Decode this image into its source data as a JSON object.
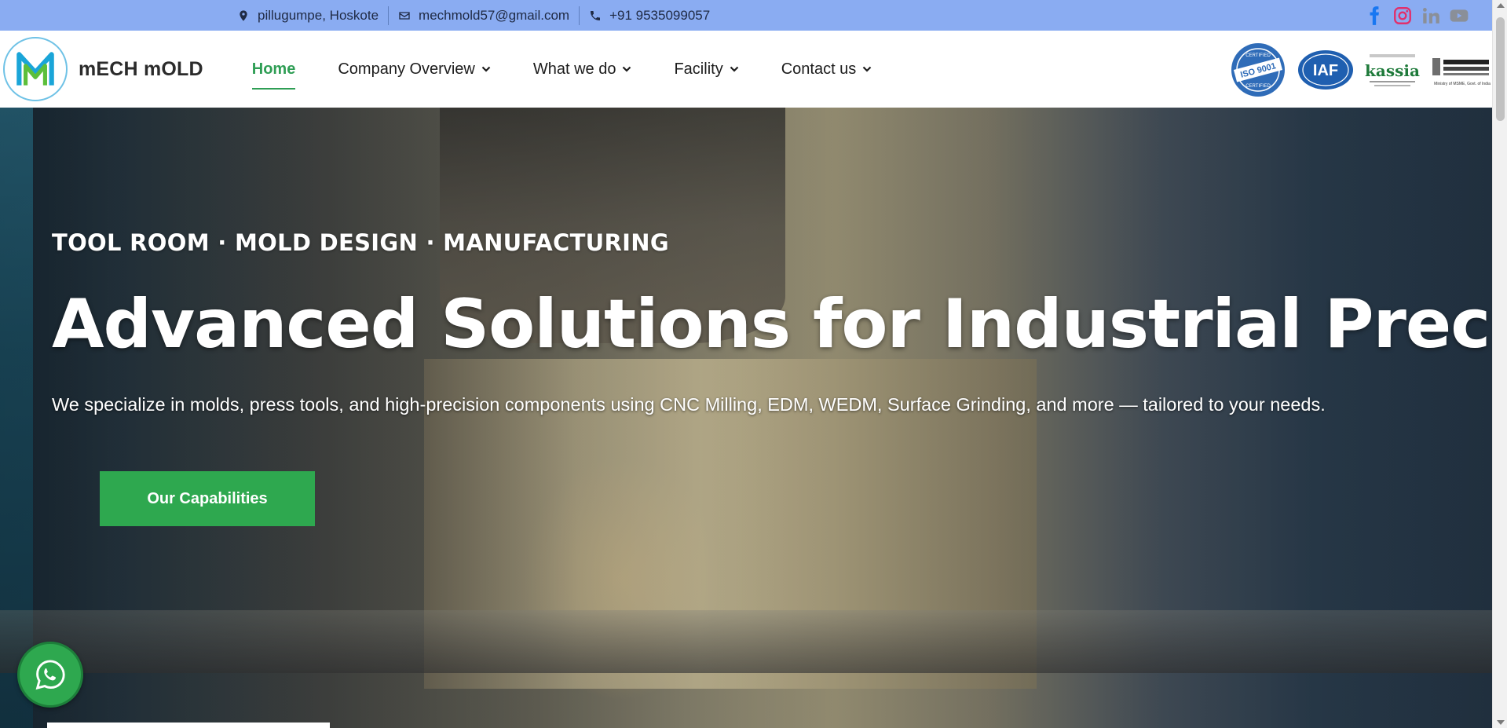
{
  "topbar": {
    "location": "pillugumpe, Hoskote",
    "email": "mechmold57@gmail.com",
    "phone": "+91 9535099057",
    "background": "#8aacf2",
    "social": [
      {
        "name": "facebook-icon",
        "color": "#1877f2"
      },
      {
        "name": "instagram-icon",
        "color": "#e1306c"
      },
      {
        "name": "linkedin-icon",
        "color": "#8a8f98"
      },
      {
        "name": "youtube-icon",
        "color": "#8a8f98"
      }
    ]
  },
  "header": {
    "brand_name": "mECH mOLD",
    "nav": [
      {
        "label": "Home",
        "active": true
      },
      {
        "label": "Company Overview",
        "dropdown": true
      },
      {
        "label": "What we do",
        "dropdown": true
      },
      {
        "label": "Facility",
        "dropdown": true
      },
      {
        "label": "Contact us",
        "dropdown": true
      }
    ],
    "certifications": {
      "iso_top": "CERTIFIED",
      "iso": "ISO 9001",
      "iso_bottom": "CERTIFIED",
      "iaf": "IAF",
      "kassia": "kassia",
      "msme_caption": "Ministry of MSME, Govt. of India"
    },
    "accent": "#2f9e55"
  },
  "hero": {
    "eyebrow": "TOOL ROOM · MOLD DESIGN · MANUFACTURING",
    "headline": "Advanced Solutions for Industrial Precision",
    "subtitle": "We specialize in molds, press tools, and high-precision components using CNC Milling, EDM, WEDM, Surface Grinding, and more — tailored to your needs.",
    "cta_label": "Our Capabilities",
    "cta_color": "#2ea84f"
  },
  "floating": {
    "whatsapp_icon": "whatsapp-icon"
  }
}
